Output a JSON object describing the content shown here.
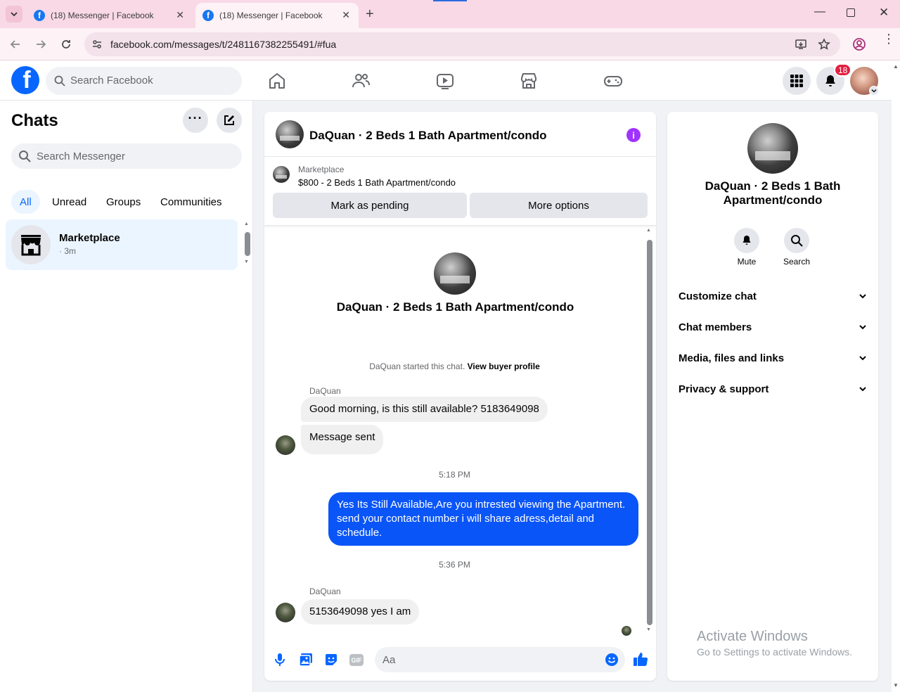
{
  "browser": {
    "tabs": [
      {
        "title": "(18) Messenger | Facebook",
        "active": false
      },
      {
        "title": "(18) Messenger | Facebook",
        "active": true
      }
    ],
    "url": "facebook.com/messages/t/2481167382255491/#fua"
  },
  "fb_header": {
    "search_placeholder": "Search Facebook",
    "notification_count": "18"
  },
  "sidebar": {
    "title": "Chats",
    "search_placeholder": "Search Messenger",
    "filters": [
      "All",
      "Unread",
      "Groups",
      "Communities"
    ],
    "chat": {
      "name": "Marketplace",
      "time": "· 3m"
    }
  },
  "conversation": {
    "title": "DaQuan · 2 Beds 1 Bath Apartment/condo",
    "listing_label": "Marketplace",
    "listing_desc": "$800 - 2 Beds 1 Bath Apartment/condo",
    "mark_pending": "Mark as pending",
    "more_options": "More options",
    "intro_name": "DaQuan · 2 Beds 1 Bath Apartment/condo",
    "started_text": "DaQuan started this chat.",
    "view_profile": "View buyer profile",
    "sender1": "DaQuan",
    "msg1": "Good morning, is this still available? 5183649098",
    "msg2": "Message sent",
    "time1": "5:18 PM",
    "msg3": "Yes Its Still Available,Are you intrested viewing the Apartment. send your contact number i will share adress,detail and schedule.",
    "time2": "5:36 PM",
    "sender2": "DaQuan",
    "msg4": "5153649098 yes I am",
    "composer_placeholder": "Aa"
  },
  "details": {
    "name": "DaQuan · 2 Beds 1 Bath Apartment/condo",
    "mute": "Mute",
    "search": "Search",
    "sections": [
      "Customize chat",
      "Chat members",
      "Media, files and links",
      "Privacy & support"
    ]
  },
  "watermark": {
    "line1": "Activate Windows",
    "line2": "Go to Settings to activate Windows."
  },
  "colors": {
    "accent": "#0866ff",
    "outgoing_bubble": "#0a55f7",
    "info_icon": "#a033ff",
    "badge": "#e41e3f"
  }
}
